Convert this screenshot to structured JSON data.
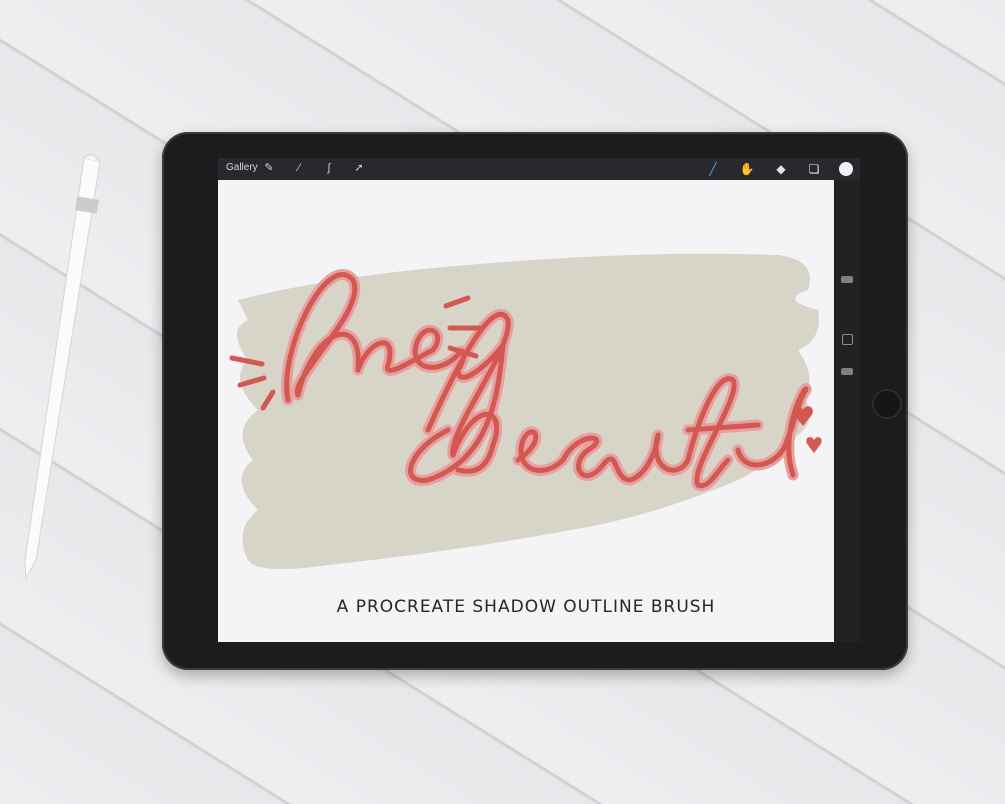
{
  "toolbar": {
    "gallery_label": "Gallery",
    "left_icons": [
      "wrench-icon",
      "wand-icon",
      "selection-icon",
      "transform-icon"
    ],
    "right_icons": [
      "brush-icon",
      "smudge-icon",
      "eraser-icon",
      "layers-icon"
    ],
    "selected_color": "#f3f3f5"
  },
  "artwork": {
    "line1": "hey",
    "line2": "beautiful",
    "caption": "A PROCREATE SHADOW OUTLINE BRUSH",
    "lettering_color": "#d4584f",
    "outline_color": "#e6a0a0",
    "swatch_color": "#d7d4c8"
  }
}
